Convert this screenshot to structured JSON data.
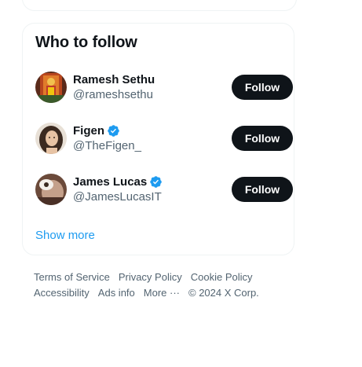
{
  "who_to_follow": {
    "title": "Who to follow",
    "users": [
      {
        "name": "Ramesh Sethu",
        "handle": "@rameshsethu",
        "verified": false,
        "follow_label": "Follow"
      },
      {
        "name": "Figen",
        "handle": "@TheFigen_",
        "verified": true,
        "follow_label": "Follow"
      },
      {
        "name": "James Lucas",
        "handle": "@JamesLucasIT",
        "verified": true,
        "follow_label": "Follow"
      }
    ],
    "show_more": "Show more"
  },
  "footer": {
    "terms": "Terms of Service",
    "privacy": "Privacy Policy",
    "cookie": "Cookie Policy",
    "accessibility": "Accessibility",
    "ads_info": "Ads info",
    "more": "More ···",
    "copyright": "© 2024 X Corp."
  },
  "colors": {
    "accent": "#1d9bf0",
    "button_bg": "#0f1419",
    "secondary_text": "#536471",
    "border": "#eff3f4"
  }
}
